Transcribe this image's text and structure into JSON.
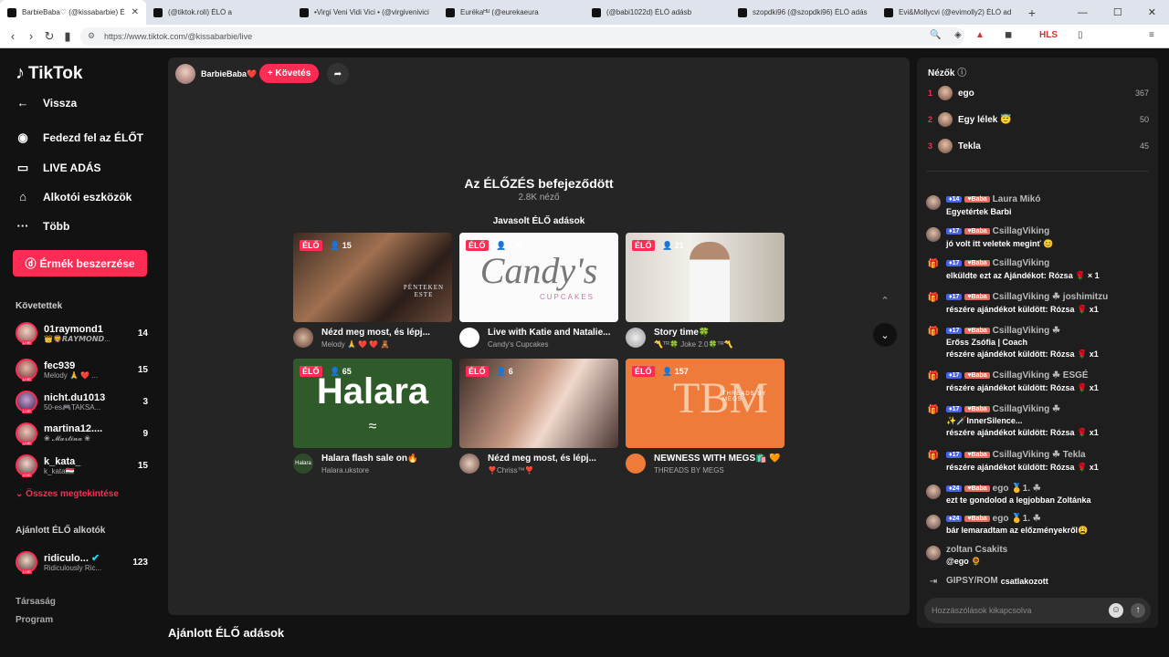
{
  "browser": {
    "tabs": [
      {
        "title": "BarbieBaba♡ (@kissabarbie) É",
        "active": true
      },
      {
        "title": "(@tiktok.roli) ÉLŐ a"
      },
      {
        "title": "•Virgi Veni Vidi Vici • (@virgivenivici"
      },
      {
        "title": "Eurékaᴴᵁ (@eurekaeura"
      },
      {
        "title": "(@babi1022d) ÉLŐ adásb"
      },
      {
        "title": "szopdki96 (@szopdki96) ÉLŐ adás"
      },
      {
        "title": "Evi&Mollycvi (@evimolly2) ÉLŐ ad"
      }
    ],
    "new_tab": "+",
    "url": "https://www.tiktok.com/@kissabarbie/live",
    "controls": {
      "minimize": "—",
      "maximize": "☐",
      "close": "✕"
    }
  },
  "sidebar": {
    "logo": "TikTok",
    "back": "Vissza",
    "nav": [
      {
        "label": "Fedezd fel az ÉLŐT",
        "icon": "explore-live-icon"
      },
      {
        "label": "LIVE ADÁS",
        "icon": "camera-icon"
      },
      {
        "label": "Alkotói eszközök",
        "icon": "creator-tools-icon"
      },
      {
        "label": "Több",
        "icon": "more-icon"
      }
    ],
    "coins_button": "Érmék beszerzése",
    "following_title": "Követettek",
    "following": [
      {
        "name": "01raymond1",
        "sub": "👑🦁𝙍𝘼𝙔𝙈𝙊𝙉𝘿...",
        "count": "14"
      },
      {
        "name": "fec939",
        "sub": "Melody 🙏 ❤️ ...",
        "count": "15"
      },
      {
        "name": "nicht.du1013",
        "sub": "50-es🎮TAKSA...",
        "count": "3"
      },
      {
        "name": "martina12....",
        "sub": "❀ 𝓜𝓪𝓻𝓽𝓲𝓷𝓪 ❀",
        "count": "9"
      },
      {
        "name": "k_kata_",
        "sub": "k_kata🇭🇺",
        "count": "15"
      }
    ],
    "see_all": "Összes megtekintése",
    "suggested_title": "Ajánlott ÉLŐ alkotók",
    "suggested": [
      {
        "name": "ridiculo...",
        "sub": "Ridiculously Ric...",
        "count": "123"
      }
    ],
    "footer": [
      "Társaság",
      "Program"
    ]
  },
  "stream": {
    "host_name": "BarbieBaba❤️",
    "follow_label": "+ Követés",
    "ended_title": "Az ÉLŐZÉS befejeződött",
    "ended_viewers": "2.8K néző",
    "recommended_title": "Javasolt ÉLŐ adások",
    "live_badge": "ÉLŐ",
    "cards": [
      {
        "viewers": "15",
        "title": "Nézd meg most, és lépj...",
        "sub": "Melody 🙏 ❤️ ❤️ 🧸",
        "thumb_text": "PÉNTEKEN ESTE"
      },
      {
        "viewers": "176",
        "title": "Live with Katie and Natalie...",
        "sub": "Candy's Cupcakes",
        "thumb_text": "Candy's",
        "thumb_sub": "CUPCAKES"
      },
      {
        "viewers": "21",
        "title": "Story time🍀",
        "sub": "〽️ᵀᴿ🍀 Joke 2.0🍀ᵀᴿ〽️"
      },
      {
        "viewers": "65",
        "title": "Halara flash sale on🔥",
        "sub": "Halara.ukstore",
        "thumb_text": "Halara",
        "avatar_text": "Halara"
      },
      {
        "viewers": "6",
        "title": "Nézd meg most, és lépj...",
        "sub": "❣️Chriss™❣️"
      },
      {
        "viewers": "157",
        "title": "NEWNESS WITH MEGS🛍️ 🧡",
        "sub": "THREADS BY MEGS",
        "thumb_text": "TBM",
        "thumb_sub": "THREADS BY MEGS"
      }
    ],
    "recommended_heading": "Ajánlott ÉLŐ adások"
  },
  "chat": {
    "viewers_title": "Nézők",
    "top_viewers": [
      {
        "rank": "1",
        "name": "ego",
        "score": "367"
      },
      {
        "rank": "2",
        "name": "Egy lélek 😇",
        "score": "50"
      },
      {
        "rank": "3",
        "name": "Tekla",
        "score": "45"
      }
    ],
    "messages": [
      {
        "type": "user",
        "level": "14",
        "fan": "Baba",
        "user": "Laura Mikó",
        "text": "Egyetértek Barbi"
      },
      {
        "type": "user",
        "level": "17",
        "fan": "Baba",
        "user": "CsillagViking",
        "text": "jó volt itt veletek meginť 😊"
      },
      {
        "type": "gift",
        "level": "17",
        "fan": "Baba",
        "user": "CsillagViking",
        "text": "elküldte ezt az Ajándékot: Rózsa 🌹 × 1"
      },
      {
        "type": "gift",
        "level": "17",
        "fan": "Baba",
        "user": "CsillagViking ☘ joshimitzu",
        "text": "részére ajándékot küldött: Rózsa 🌹 x1"
      },
      {
        "type": "gift",
        "level": "17",
        "fan": "Baba",
        "user": "CsillagViking ☘",
        "text": "Erőss Zsófia | Coach",
        "text2": "részére ajándékot küldött: Rózsa 🌹 x1"
      },
      {
        "type": "gift",
        "level": "17",
        "fan": "Baba",
        "user": "CsillagViking ☘ ESGÉ",
        "text": "részére ajándékot küldött: Rózsa 🌹 x1"
      },
      {
        "type": "gift",
        "level": "17",
        "fan": "Baba",
        "user": "CsillagViking ☘",
        "text": "✨🗡️InnerSilence...",
        "text2": "részére ajándékot küldött: Rózsa 🌹 x1"
      },
      {
        "type": "gift",
        "level": "17",
        "fan": "Baba",
        "user": "CsillagViking ☘ Tekla",
        "text": "részére ajándékot küldött: Rózsa 🌹 x1"
      },
      {
        "type": "user",
        "level": "24",
        "fan": "Baba",
        "user": "ego 🥇1. ☘",
        "text": "ezt te gondolod a legjobban Zoltánka"
      },
      {
        "type": "user",
        "level": "24",
        "fan": "Baba",
        "user": "ego 🥇1. ☘",
        "text": "bár lemaradtam az előzményekről😩"
      },
      {
        "type": "user",
        "user": "zoltan Csakits",
        "text": "@ego 🌻"
      },
      {
        "type": "join",
        "user": "GIPSY/ROM",
        "text": "csatlakozott"
      }
    ],
    "input_placeholder": "Hozzászólások kikapcsolva"
  }
}
